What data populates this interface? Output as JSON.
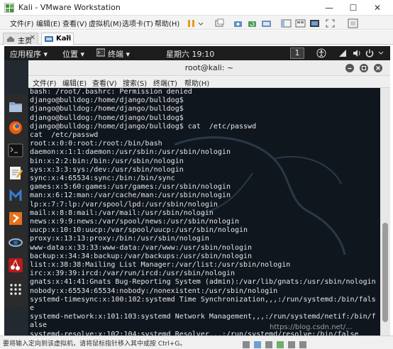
{
  "window": {
    "title": "Kali - VMware Workstation",
    "minimize_glyph": "—",
    "maximize_glyph": "☐",
    "close_glyph": "✕"
  },
  "vm_menu": {
    "items": [
      {
        "label": "文件(F)"
      },
      {
        "label": "编辑(E)"
      },
      {
        "label": "查看(V)"
      },
      {
        "label": "虚拟机(M)"
      },
      {
        "label": "选项卡(T)"
      },
      {
        "label": "帮助(H)"
      }
    ]
  },
  "vm_tabs": {
    "items": [
      {
        "label": "主页",
        "icon": "home-icon",
        "close": "✕"
      },
      {
        "label": "Kali",
        "icon": "vm-icon",
        "close": "✕"
      }
    ]
  },
  "kali_topbar": {
    "applications": "应用程序 ▾",
    "places": "位置 ▾",
    "terminal": "终端 ▾",
    "clock": "星期六 19:10",
    "workspace": "1"
  },
  "terminal": {
    "title": "root@kali: ~",
    "menu": [
      {
        "label": "文件(F)"
      },
      {
        "label": "编辑(E)"
      },
      {
        "label": "查看(V)"
      },
      {
        "label": "搜索(S)"
      },
      {
        "label": "终端(T)"
      },
      {
        "label": "帮助(H)"
      }
    ],
    "lines": [
      "bash: /root/.bashrc: Permission denied",
      "django@bulldog:/home/django/bulldog$",
      "django@bulldog:/home/django/bulldog$",
      "django@bulldog:/home/django/bulldog$",
      "django@bulldog:/home/django/bulldog$ cat  /etc/passwd",
      "cat  /etc/passwd",
      "root:x:0:0:root:/root:/bin/bash",
      "daemon:x:1:1:daemon:/usr/sbin:/usr/sbin/nologin",
      "bin:x:2:2:bin:/bin:/usr/sbin/nologin",
      "sys:x:3:3:sys:/dev:/usr/sbin/nologin",
      "sync:x:4:65534:sync:/bin:/bin/sync",
      "games:x:5:60:games:/usr/games:/usr/sbin/nologin",
      "man:x:6:12:man:/var/cache/man:/usr/sbin/nologin",
      "lp:x:7:7:lp:/var/spool/lpd:/usr/sbin/nologin",
      "mail:x:8:8:mail:/var/mail:/usr/sbin/nologin",
      "news:x:9:9:news:/var/spool/news:/usr/sbin/nologin",
      "uucp:x:10:10:uucp:/var/spool/uucp:/usr/sbin/nologin",
      "proxy:x:13:13:proxy:/bin:/usr/sbin/nologin",
      "www-data:x:33:33:www-data:/var/www:/usr/sbin/nologin",
      "backup:x:34:34:backup:/var/backups:/usr/sbin/nologin",
      "list:x:38:38:Mailing List Manager:/var/list:/usr/sbin/nologin",
      "irc:x:39:39:ircd:/var/run/ircd:/usr/sbin/nologin",
      "gnats:x:41:41:Gnats Bug-Reporting System (admin):/var/lib/gnats:/usr/sbin/nologin",
      "nobody:x:65534:65534:nobody:/nonexistent:/usr/sbin/nologin",
      "systemd-timesync:x:100:102:systemd Time Synchronization,,,:/run/systemd:/bin/fals",
      "e",
      "systemd-network:x:101:103:systemd Network Management,,,:/run/systemd/netif:/bin/f",
      "alse",
      "systemd-resolve:x:102:104:systemd Resolver,,,:/run/systemd/resolve:/bin/false"
    ]
  },
  "status_bar": {
    "text": "要将输入定向到该虚拟机，请将鼠标指针移入其中或按 Ctrl+G。"
  },
  "watermark": "https://blog.csdn.net/..."
}
